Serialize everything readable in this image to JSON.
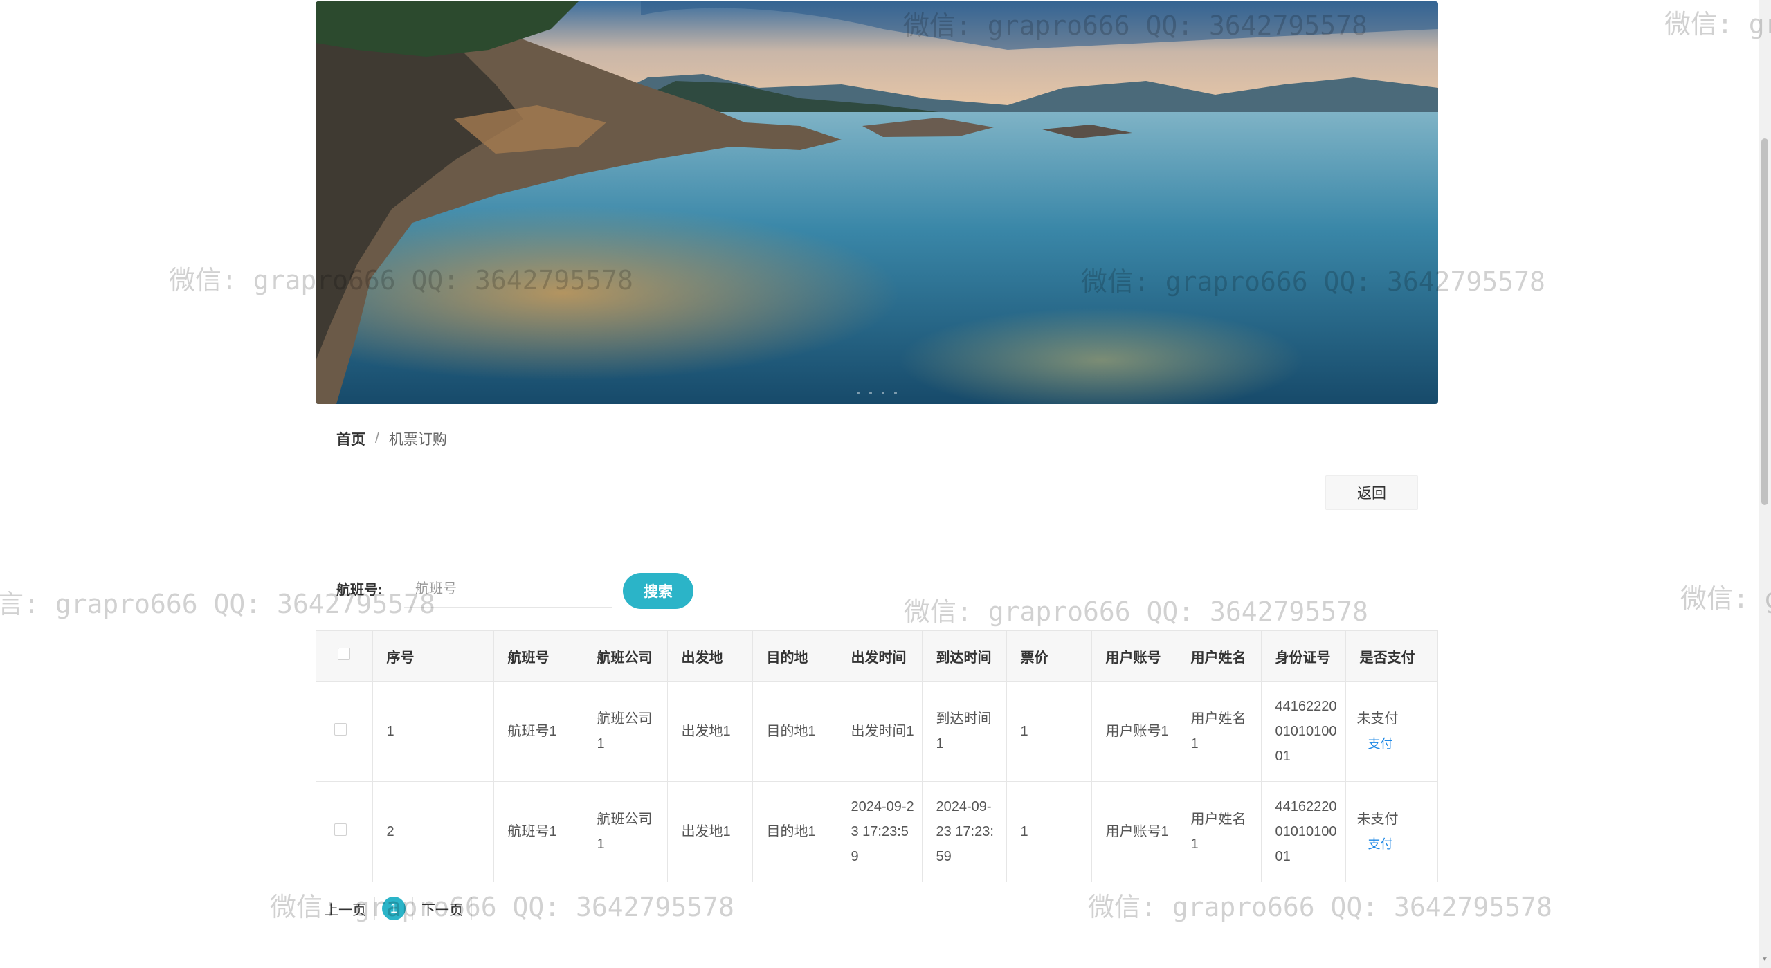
{
  "breadcrumb": {
    "home": "首页",
    "separator": "/",
    "current": "机票订购"
  },
  "actions": {
    "back_label": "返回"
  },
  "search": {
    "label": "航班号:",
    "placeholder": "航班号",
    "button_label": "搜索"
  },
  "table": {
    "headers": [
      "序号",
      "航班号",
      "航班公司",
      "出发地",
      "目的地",
      "出发时间",
      "到达时间",
      "票价",
      "用户账号",
      "用户姓名",
      "身份证号",
      "是否支付"
    ],
    "rows": [
      {
        "index": "1",
        "flight_no": "航班号1",
        "company": "航班公司1",
        "departure": "出发地1",
        "destination": "目的地1",
        "depart_time": "出发时间1",
        "arrive_time": "到达时间1",
        "price": "1",
        "user_account": "用户账号1",
        "user_name": "用户姓名1",
        "id_number": "441622200101010001",
        "paid_status": "未支付",
        "pay_action": "支付"
      },
      {
        "index": "2",
        "flight_no": "航班号1",
        "company": "航班公司1",
        "departure": "出发地1",
        "destination": "目的地1",
        "depart_time": "2024-09-23 17:23:59",
        "arrive_time": "2024-09-23 17:23:59",
        "price": "1",
        "user_account": "用户账号1",
        "user_name": "用户姓名1",
        "id_number": "441622200101010001",
        "paid_status": "未支付",
        "pay_action": "支付"
      }
    ]
  },
  "pagination": {
    "prev_label": "上一页",
    "current_page": "1",
    "next_label": "下一页"
  },
  "watermark": {
    "text": "微信: grapro666 QQ: 3642795578",
    "partial_right": "微信: gr",
    "partial_left": "言: grapro666 QQ: 3642795578",
    "partial_right2": "微信: g"
  },
  "colors": {
    "accent": "#2bb4c8",
    "link": "#1e88e5",
    "header_bg": "#f7f7f7",
    "border": "#e6e6e6"
  }
}
